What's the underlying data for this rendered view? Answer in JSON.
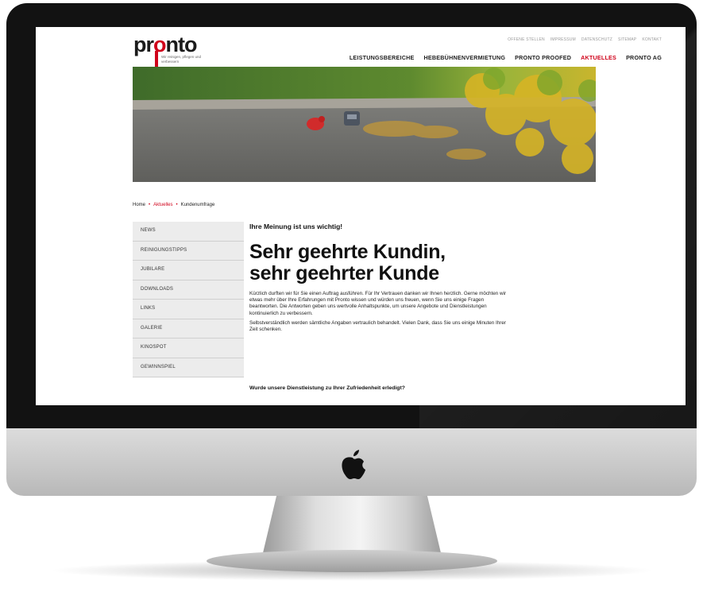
{
  "site": {
    "logo_text_pre": "pr",
    "logo_text_o": "o",
    "logo_text_post": "nto",
    "logo_tagline": "Wir reinigen, pflegen und verbessern"
  },
  "topnav": [
    "OFFENE STELLEN",
    "IMPRESSUM",
    "DATENSCHUTZ",
    "SITEMAP",
    "KONTAKT"
  ],
  "mainnav": [
    {
      "label": "LEISTUNGSBEREICHE",
      "active": false
    },
    {
      "label": "HEBEBÜHNENVERMIETUNG",
      "active": false
    },
    {
      "label": "PRONTO PROOFED",
      "active": false
    },
    {
      "label": "AKTUELLES",
      "active": true
    },
    {
      "label": "PRONTO AG",
      "active": false
    }
  ],
  "breadcrumb": {
    "home": "Home",
    "section": "Aktuelles",
    "current": "Kundenumfrage"
  },
  "sidebar": [
    "NEWS",
    "REINIGUNGSTIPPS",
    "JUBILARE",
    "DOWNLOADS",
    "LINKS",
    "GALERIE",
    "KINOSPOT",
    "GEWINNSPIEL"
  ],
  "content": {
    "subhead": "Ihre Meinung ist uns wichtig!",
    "headline_line1": "Sehr geehrte Kundin,",
    "headline_line2": "sehr geehrter Kunde",
    "paragraph1": "Kürzlich durften wir für Sie einen Auftrag ausführen. Für Ihr Vertrauen danken wir Ihnen herzlich. Gerne möchten wir etwas mehr über Ihre Erfahrungen mit Pronto wissen und würden uns freuen, wenn Sie uns einige Fragen beantworten. Die Antworten geben uns wertvolle Anhaltspunkte, um unsere Angebote und Dienstleistungen kontinuierlich zu verbessern.",
    "paragraph2": "Selbstverständlich werden sämtliche Angaben vertraulich behandelt. Vielen Dank, dass Sie uns einige Minuten Ihrer Zeit schenken.",
    "question1": "Wurde unsere Dienstleistung zu Ihrer Zufriedenheit erledigt?"
  },
  "colors": {
    "accent": "#d0021b",
    "sidebar_bg": "#ececec",
    "bezel": "#121212"
  }
}
